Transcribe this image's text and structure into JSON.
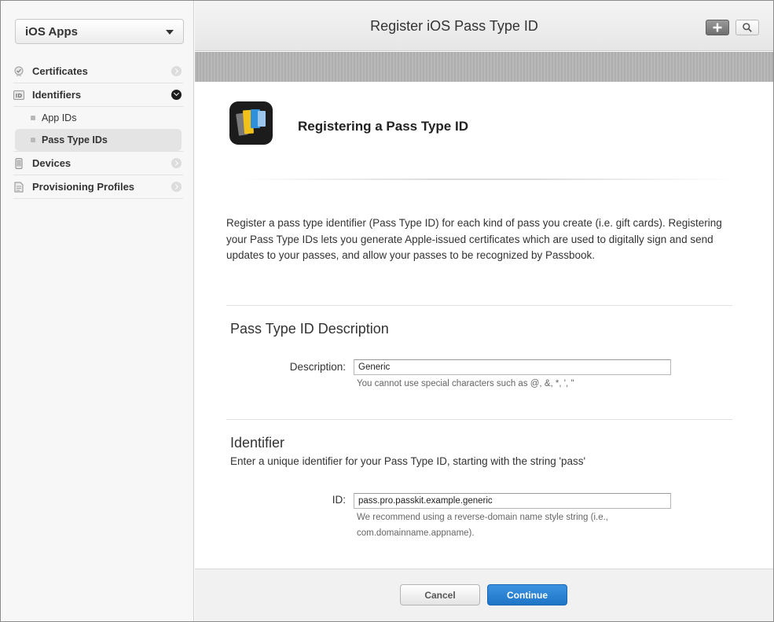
{
  "sidebar": {
    "platform": "iOS Apps",
    "items": [
      {
        "label": "Certificates",
        "icon": "certificate-icon"
      },
      {
        "label": "Identifiers",
        "icon": "id-icon",
        "expanded": true,
        "children": [
          {
            "label": "App IDs"
          },
          {
            "label": "Pass Type IDs",
            "active": true
          }
        ]
      },
      {
        "label": "Devices",
        "icon": "device-icon"
      },
      {
        "label": "Provisioning Profiles",
        "icon": "profile-icon"
      }
    ]
  },
  "header": {
    "title": "Register iOS Pass Type ID",
    "add_icon": "plus-icon",
    "search_icon": "search-icon"
  },
  "main": {
    "heading": "Registering a Pass Type ID",
    "intro": "Register a pass type identifier (Pass Type ID) for each kind of pass you create (i.e. gift cards). Registering your Pass Type IDs lets you generate Apple-issued certificates which are used to digitally sign and send updates to your passes, and allow your passes to be recognized by Passbook.",
    "description_section": {
      "title": "Pass Type ID Description",
      "label": "Description:",
      "value": "Generic",
      "hint": "You cannot use special characters such as @, &, *, ', \""
    },
    "identifier_section": {
      "title": "Identifier",
      "subtitle": "Enter a unique identifier for your Pass Type ID, starting with the string 'pass'",
      "label": "ID:",
      "value": "pass.pro.passkit.example.generic",
      "hint": "We recommend using a reverse-domain name style string (i.e., com.domainname.appname)."
    }
  },
  "footer": {
    "cancel_label": "Cancel",
    "continue_label": "Continue"
  },
  "colors": {
    "accent": "#2a83d6",
    "header_stripe": "#b3b3b3"
  }
}
